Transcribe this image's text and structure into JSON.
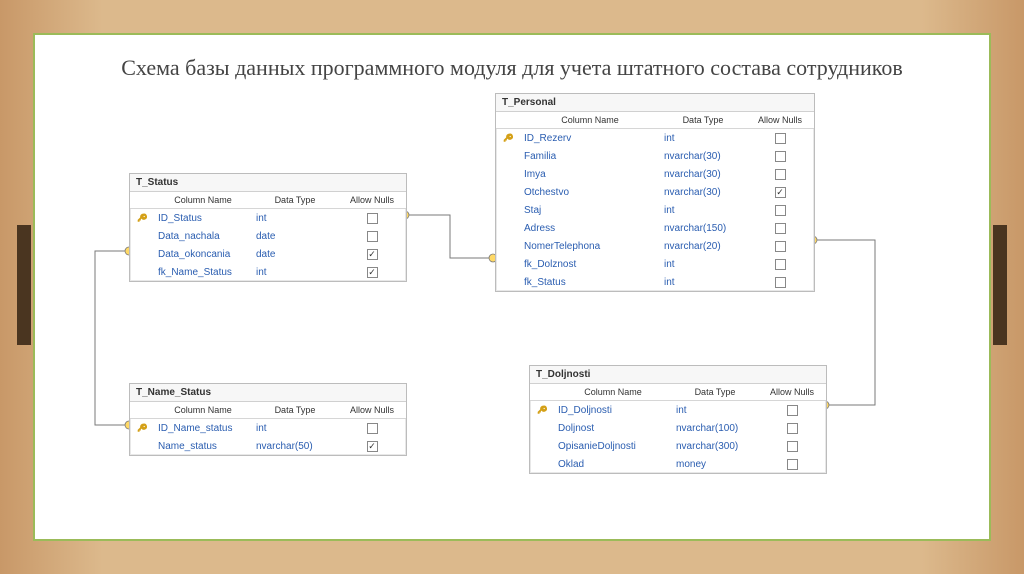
{
  "slide": {
    "title": "Схема базы данных программного модуля для учета штатного состава сотрудников"
  },
  "headers": {
    "col_name": "Column Name",
    "data_type": "Data Type",
    "allow_nulls": "Allow Nulls"
  },
  "tables": {
    "status": {
      "name": "T_Status",
      "rows": [
        {
          "pk": true,
          "name": "ID_Status",
          "type": "int",
          "null": false
        },
        {
          "pk": false,
          "name": "Data_nachala",
          "type": "date",
          "null": false
        },
        {
          "pk": false,
          "name": "Data_okoncania",
          "type": "date",
          "null": true
        },
        {
          "pk": false,
          "name": "fk_Name_Status",
          "type": "int",
          "null": true
        }
      ]
    },
    "name_status": {
      "name": "T_Name_Status",
      "rows": [
        {
          "pk": true,
          "name": "ID_Name_status",
          "type": "int",
          "null": false
        },
        {
          "pk": false,
          "name": "Name_status",
          "type": "nvarchar(50)",
          "null": true
        }
      ]
    },
    "personal": {
      "name": "T_Personal",
      "rows": [
        {
          "pk": true,
          "name": "ID_Rezerv",
          "type": "int",
          "null": false
        },
        {
          "pk": false,
          "name": "Familia",
          "type": "nvarchar(30)",
          "null": false
        },
        {
          "pk": false,
          "name": "Imya",
          "type": "nvarchar(30)",
          "null": false
        },
        {
          "pk": false,
          "name": "Otchestvo",
          "type": "nvarchar(30)",
          "null": true
        },
        {
          "pk": false,
          "name": "Staj",
          "type": "int",
          "null": false
        },
        {
          "pk": false,
          "name": "Adress",
          "type": "nvarchar(150)",
          "null": false
        },
        {
          "pk": false,
          "name": "NomerTelephona",
          "type": "nvarchar(20)",
          "null": false
        },
        {
          "pk": false,
          "name": "fk_Dolznost",
          "type": "int",
          "null": false
        },
        {
          "pk": false,
          "name": "fk_Status",
          "type": "int",
          "null": false
        }
      ]
    },
    "doljnosti": {
      "name": "T_Doljnosti",
      "rows": [
        {
          "pk": true,
          "name": "ID_Doljnosti",
          "type": "int",
          "null": false
        },
        {
          "pk": false,
          "name": "Doljnost",
          "type": "nvarchar(100)",
          "null": false
        },
        {
          "pk": false,
          "name": "OpisanieDoljnosti",
          "type": "nvarchar(300)",
          "null": false
        },
        {
          "pk": false,
          "name": "Oklad",
          "type": "money",
          "null": false
        }
      ]
    }
  }
}
